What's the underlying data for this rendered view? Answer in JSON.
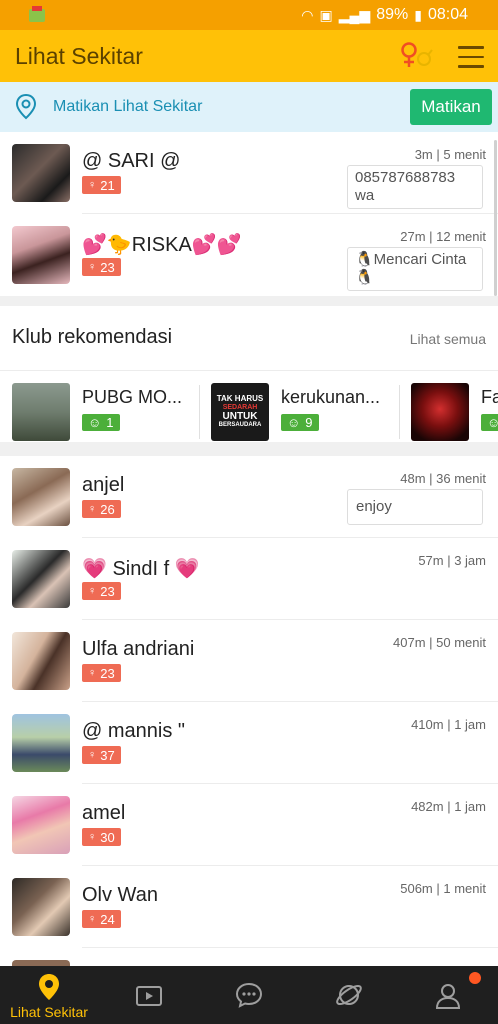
{
  "status_bar": {
    "battery": "89%",
    "time": "08:04"
  },
  "app_bar": {
    "title": "Lihat Sekitar"
  },
  "banner": {
    "text": "Matikan Lihat Sekitar",
    "button": "Matikan"
  },
  "nearby_top": [
    {
      "name": "@ SARI @",
      "age": "21",
      "meta": "3m | 5 menit",
      "status_line1": "085787688783",
      "status_line2": "wa"
    },
    {
      "name": "💕🐤RISKA💕💕",
      "age": "23",
      "meta": "27m | 12 menit",
      "status_line1": "🐧Mencari Cinta",
      "status_line2": "🐧"
    }
  ],
  "clubs": {
    "title": "Klub rekomendasi",
    "see_all": "Lihat semua",
    "items": [
      {
        "name": "PUBG MO...",
        "members": "1"
      },
      {
        "name": "kerukunan...",
        "members": "9",
        "logo_text": [
          "TAK HARUS",
          "SEDARAH",
          "UNTUK",
          "BERSAUDARA"
        ]
      },
      {
        "name": "Fa",
        "members": ""
      }
    ]
  },
  "nearby": [
    {
      "name": "anjel",
      "age": "26",
      "meta": "48m | 36 menit",
      "status": "enjoy"
    },
    {
      "name": "💗 SindI f 💗",
      "age": "23",
      "meta": "57m | 3 jam"
    },
    {
      "name": "Ulfa andriani",
      "age": "23",
      "meta": "407m | 50 menit"
    },
    {
      "name": "@ mannis \"",
      "age": "37",
      "meta": "410m | 1 jam"
    },
    {
      "name": "amel",
      "age": "30",
      "meta": "482m | 1 jam"
    },
    {
      "name": "Olv Wan",
      "age": "24",
      "meta": "506m | 1 menit"
    }
  ],
  "bottom_nav": {
    "items": [
      {
        "label": "Lihat Sekitar",
        "icon": "location-pin-icon"
      },
      {
        "label": "",
        "icon": "video-icon"
      },
      {
        "label": "",
        "icon": "chat-icon"
      },
      {
        "label": "",
        "icon": "planet-icon"
      },
      {
        "label": "",
        "icon": "profile-icon"
      }
    ]
  },
  "colors": {
    "accent": "#ffc107",
    "status_bar": "#f5a000",
    "age_badge": "#ef6b54",
    "button_green": "#1fb871",
    "nav_bg": "#1f1f1f"
  }
}
